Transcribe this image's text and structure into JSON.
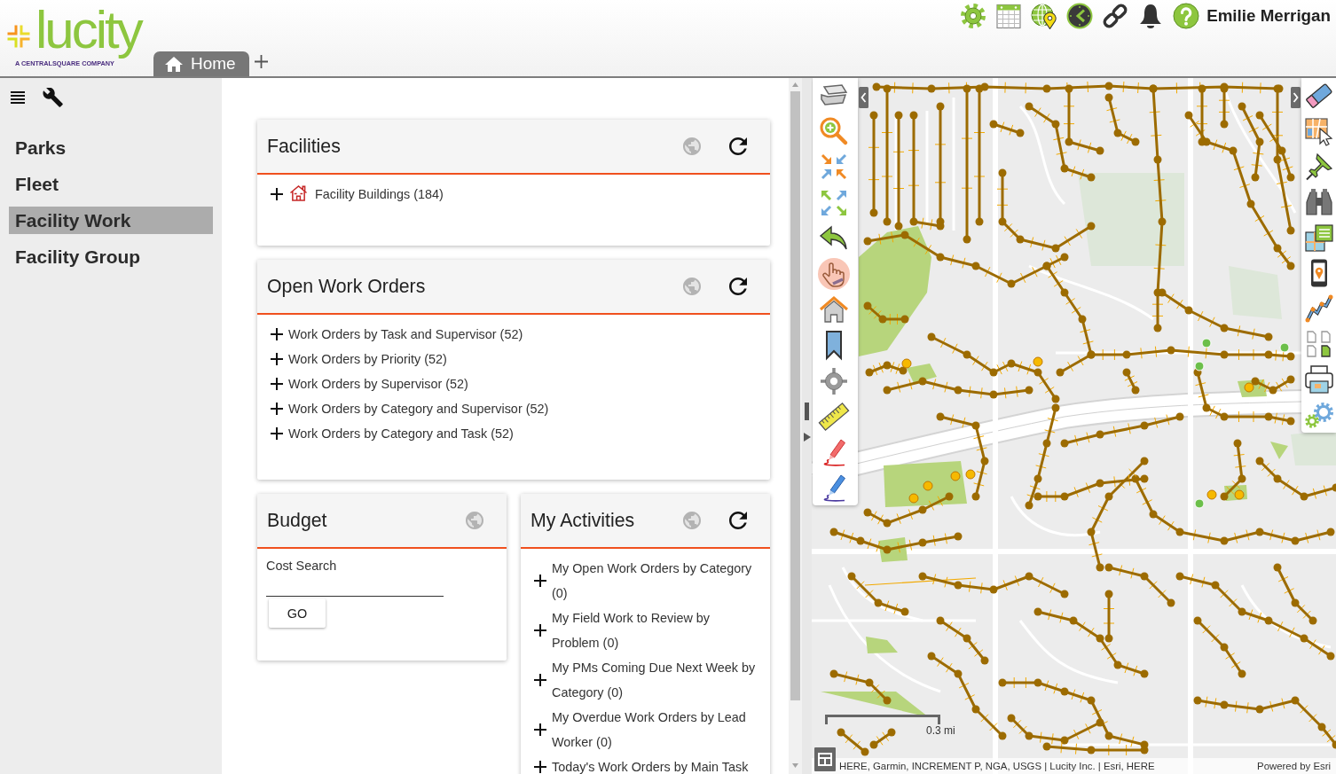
{
  "header": {
    "logo": {
      "wordmark": "lucity",
      "tagline": "A CENTRALSQUARE COMPANY"
    },
    "tabs": [
      {
        "label": "Home",
        "selected": true
      }
    ],
    "user_name": "Emilie Merrigan"
  },
  "sidebar": {
    "items": [
      {
        "label": "Parks",
        "selected": false
      },
      {
        "label": "Fleet",
        "selected": false
      },
      {
        "label": "Facility Work",
        "selected": true
      },
      {
        "label": "Facility Group",
        "selected": false
      }
    ]
  },
  "dashboard": {
    "rows": [
      {
        "cards": [
          {
            "title": "Facilities",
            "kind": "layers",
            "refresh": true,
            "items": [
              "Facility Buildings (184)"
            ]
          }
        ]
      },
      {
        "cards": [
          {
            "title": "Open Work Orders",
            "kind": "queries",
            "refresh": true,
            "items": [
              "Work Orders by Task and Supervisor (52)",
              "Work Orders by Priority (52)",
              "Work Orders by Supervisor (52)",
              "Work Orders by Category and Supervisor (52)",
              "Work Orders by Category and Task (52)"
            ]
          }
        ]
      },
      {
        "cards": [
          {
            "title": "Budget",
            "kind": "search",
            "refresh": false,
            "field_label": "Cost Search",
            "button": "GO"
          },
          {
            "title": "My Activities",
            "kind": "queries",
            "refresh": true,
            "items": [
              "My Open Work Orders by Category (0)",
              "My Field Work to Review by Problem (0)",
              "My PMs Coming Due Next Week by Category (0)",
              "My Overdue Work Orders by Lead Worker (0)",
              "Today's Work Orders by Main Task"
            ]
          }
        ]
      }
    ]
  },
  "map": {
    "tools": [
      {
        "selected": false
      },
      {
        "selected": false
      },
      {
        "selected": false
      },
      {
        "selected": false
      },
      {
        "selected": false
      },
      {
        "selected": true
      },
      {
        "selected": false
      },
      {
        "selected": false
      },
      {
        "selected": false
      },
      {
        "selected": false
      },
      {
        "selected": false
      },
      {
        "selected": false
      }
    ],
    "scale_label": "0.3 mi",
    "attribution": "HERE, Garmin, INCREMENT P, NGA, USGS | Lucity Inc. | Esri, HERE",
    "credit": "Powered by Esri"
  }
}
